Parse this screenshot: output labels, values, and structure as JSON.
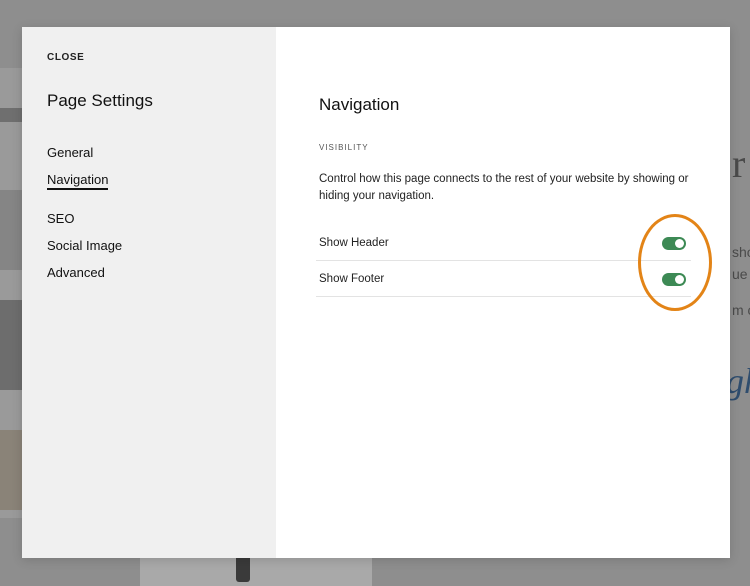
{
  "background_site": {
    "right_text_lines": [
      "r g",
      "sho",
      "ue",
      "m c",
      "gh"
    ]
  },
  "sidebar": {
    "close_label": "CLOSE",
    "title": "Page Settings",
    "items": [
      {
        "label": "General",
        "active": false
      },
      {
        "label": "Navigation",
        "active": true
      },
      {
        "label": "SEO",
        "active": false
      },
      {
        "label": "Social Image",
        "active": false
      },
      {
        "label": "Advanced",
        "active": false
      }
    ]
  },
  "content": {
    "title": "Navigation",
    "section_label": "VISIBILITY",
    "description": "Control how this page connects to the rest of your website by showing or hiding your navigation.",
    "toggles": [
      {
        "label": "Show Header",
        "on": true
      },
      {
        "label": "Show Footer",
        "on": true
      }
    ]
  },
  "colors": {
    "toggle_on": "#3d8a55",
    "highlight": "#e38417",
    "sidebar_bg": "#f0f0f0"
  },
  "icons": {
    "toggle": "toggle-switch-icon"
  }
}
